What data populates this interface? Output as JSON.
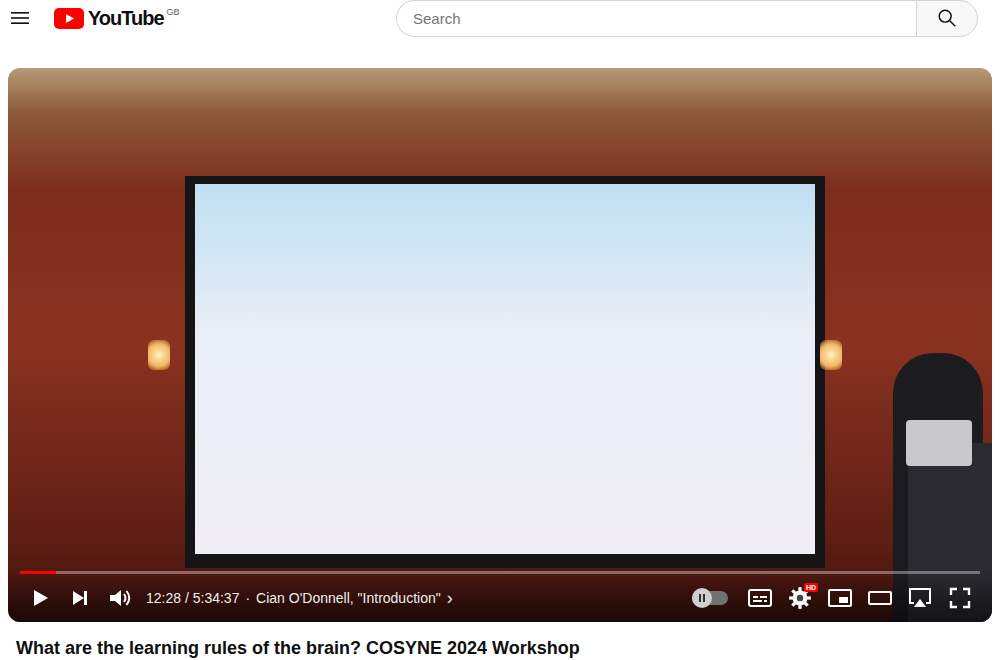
{
  "logo": {
    "text": "YouTube",
    "region": "GB"
  },
  "search": {
    "placeholder": "Search"
  },
  "player": {
    "playing": false,
    "muted": false,
    "progress": {
      "level": 0.037
    },
    "time": "12:28 / 5:34:37",
    "separator": "·",
    "chapter": "Cian O'Donnell, \"Introduction\"",
    "chapter_arrow": "›",
    "autoplay": {
      "on": false
    },
    "quality_badge": "HD"
  },
  "video": {
    "title": "What are the learning rules of the brain? COSYNE 2024 Workshop"
  }
}
